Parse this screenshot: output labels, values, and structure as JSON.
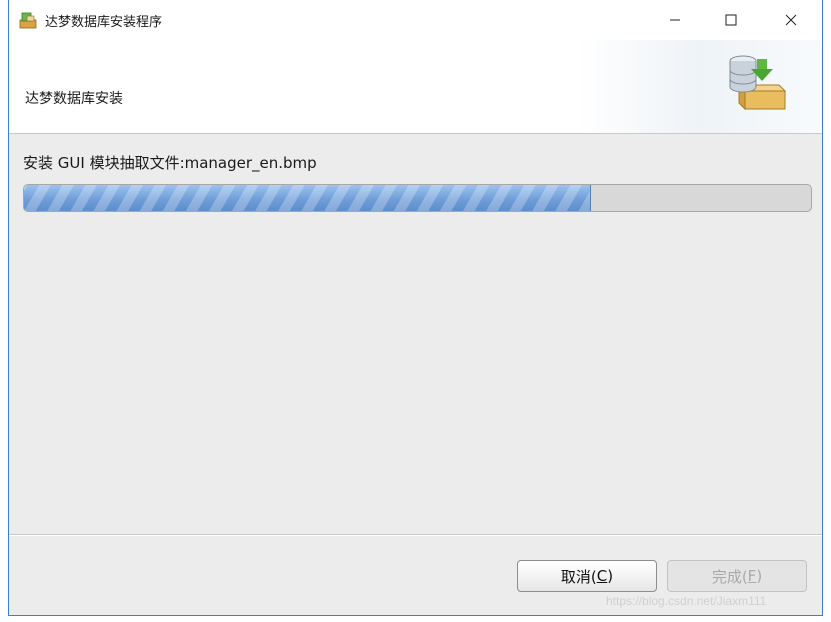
{
  "window": {
    "title": "达梦数据库安装程序",
    "controls": {
      "minimize_icon": "minimize-icon",
      "maximize_icon": "maximize-icon",
      "close_icon": "close-icon"
    }
  },
  "header": {
    "title": "达梦数据库安装",
    "icon": "database-install-icon"
  },
  "main": {
    "status_text": "安装 GUI 模块抽取文件:manager_en.bmp",
    "progress_fraction": 0.72
  },
  "footer": {
    "cancel": {
      "label": "取消(",
      "mnemonic": "C",
      "suffix": ")"
    },
    "finish": {
      "label": "完成(",
      "mnemonic": "F",
      "suffix": ")",
      "enabled": false
    }
  },
  "watermark": "https://blog.csdn.net/Jiaxm111",
  "colors": {
    "accent": "#3b7fd1",
    "progress": "#6f9ed8",
    "disabled_text": "#a9a9a9"
  }
}
